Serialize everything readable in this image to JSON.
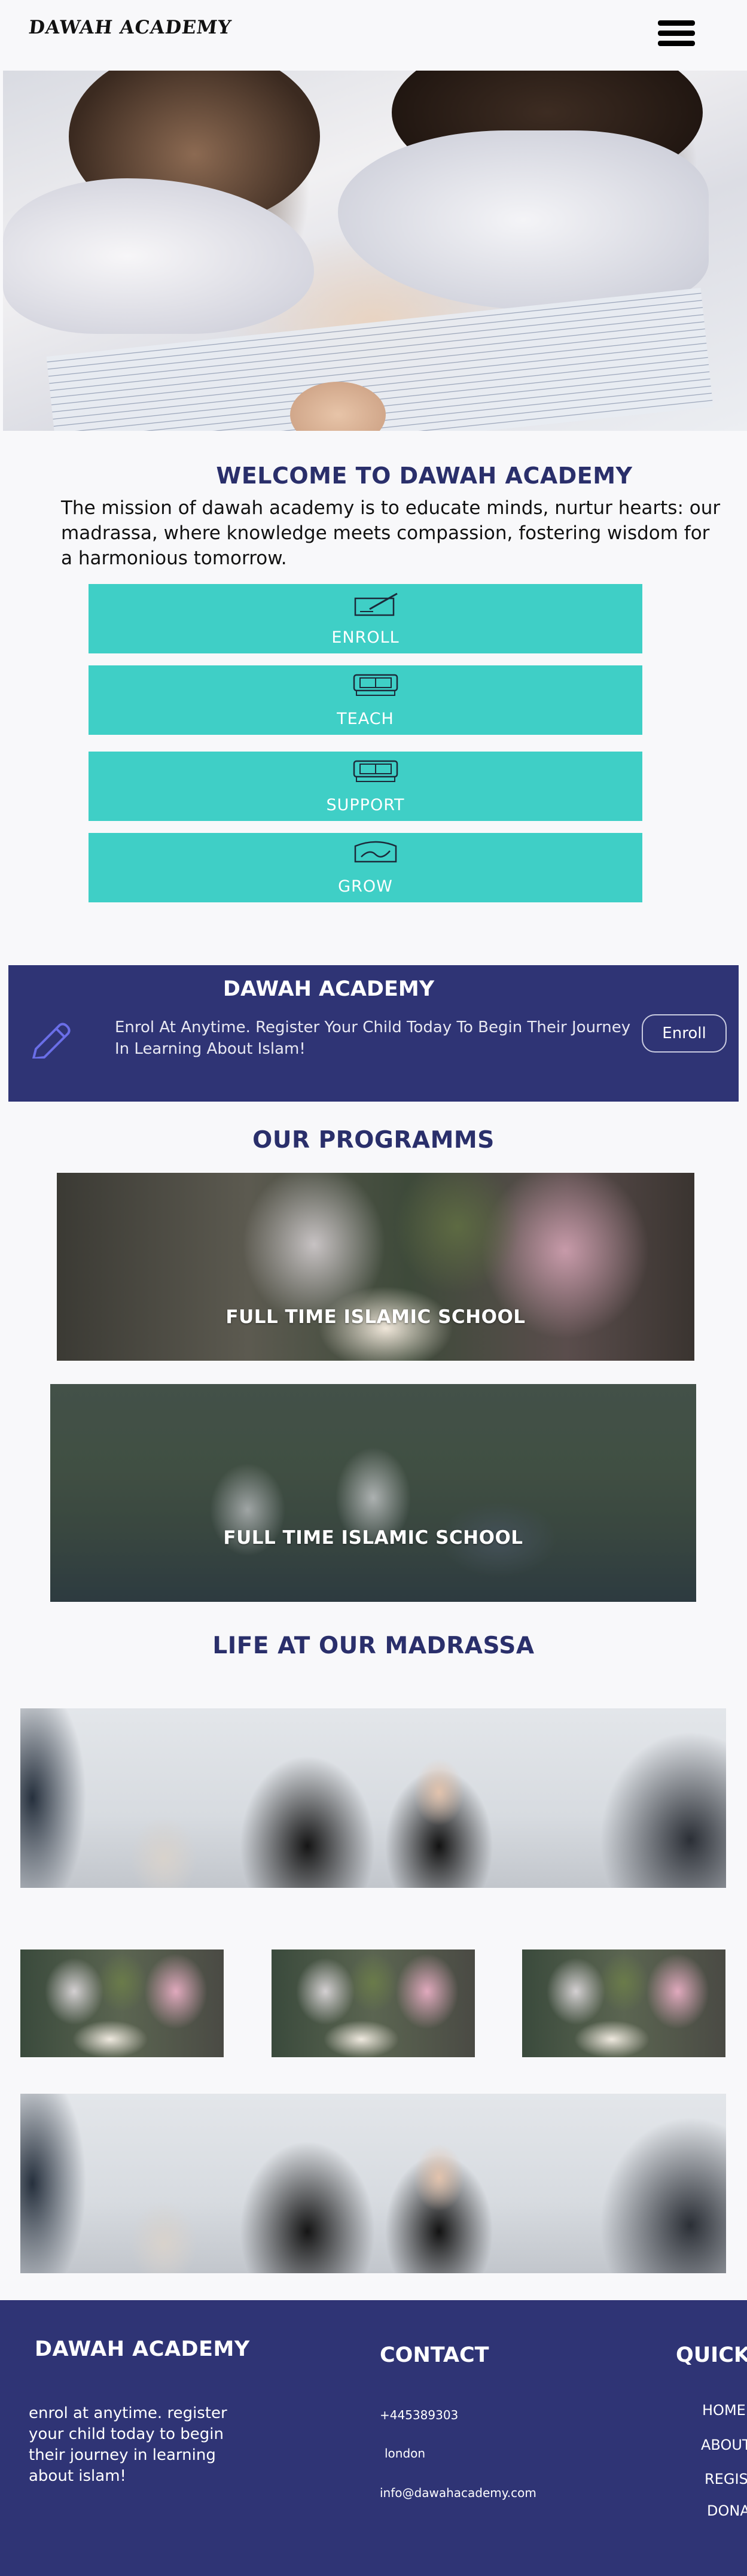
{
  "header": {
    "logo": "DAWAH ACADEMY",
    "menu_icon": "hamburger-menu-icon"
  },
  "hero": {
    "image": "children-reading-quran-photo"
  },
  "welcome": {
    "title": "WELCOME TO DAWAH ACADEMY",
    "mission": "The mission of dawah academy is to educate minds, nurtur hearts: our madrassa, where knowledge meets compassion, fostering wisdom for a harmonious tomorrow."
  },
  "features": [
    {
      "label": "ENROLL",
      "icon": "pen-writing-icon"
    },
    {
      "label": "TEACH",
      "icon": "books-icon"
    },
    {
      "label": "SUPPORT",
      "icon": "books-icon"
    },
    {
      "label": "GROW",
      "icon": "growth-box-icon"
    }
  ],
  "banner": {
    "title": "DAWAH ACADEMY",
    "text": "Enrol At Anytime. Register Your Child Today To Begin Their Journey In Learning About Islam!",
    "button": "Enroll",
    "icon": "pencil-icon"
  },
  "programs": {
    "title": "OUR PROGRAMMS",
    "items": [
      {
        "label": "FULL TIME ISLAMIC SCHOOL"
      },
      {
        "label": "FULL TIME ISLAMIC SCHOOL"
      }
    ]
  },
  "life": {
    "title": "LIFE AT OUR MADRASSA"
  },
  "footer": {
    "brand": "DAWAH ACADEMY",
    "description": "enrol at anytime. register your child today to begin their journey in learning about islam!",
    "contact_title": "CONTACT",
    "phone": "+445389303",
    "city": "london",
    "email": "info@dawahacademy.com",
    "quick_title": "QUICK",
    "links": [
      "HOME",
      "ABOUT",
      "REGIS",
      "DONA"
    ]
  },
  "colors": {
    "navy": "#2f3475",
    "title_navy": "#2a2f6b",
    "teal": "#3fcfc6",
    "background": "#f8f8fa"
  }
}
